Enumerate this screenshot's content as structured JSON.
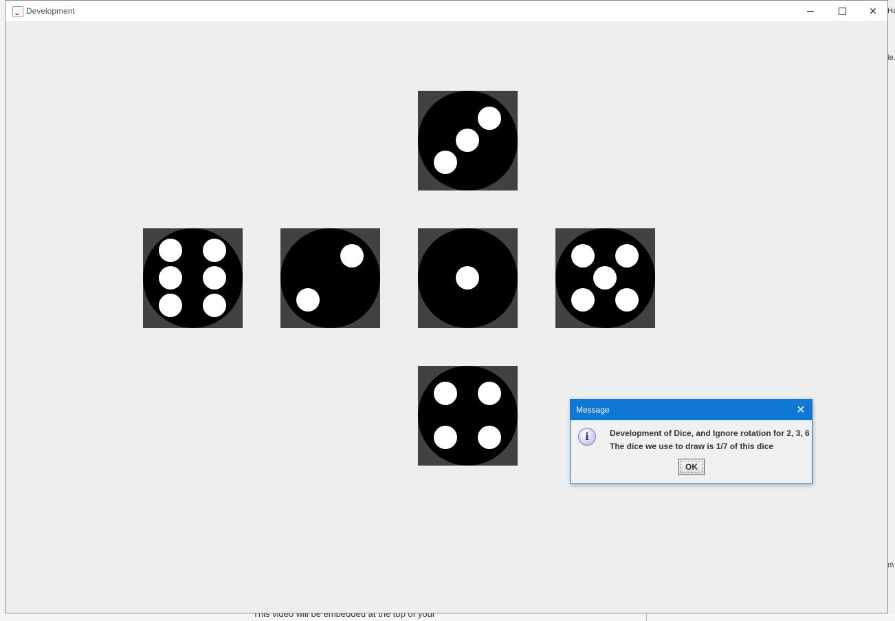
{
  "window": {
    "title": "Development",
    "controls": [
      "minimize-icon",
      "maximize-icon",
      "close-icon"
    ]
  },
  "dice": [
    {
      "face_value": 3
    },
    {
      "face_value": 6
    },
    {
      "face_value": 2
    },
    {
      "face_value": 1
    },
    {
      "face_value": 5
    },
    {
      "face_value": 4
    }
  ],
  "dialog": {
    "title": "Message",
    "icon": "info-icon",
    "icon_glyph": "i",
    "line1": "Development of Dice, and Ignore rotation for 2, 3, 6",
    "line2": "The dice we use to draw is 1/7 of this dice",
    "ok_label": "OK"
  },
  "background": {
    "bottom_text": "This video will be embedded at the top of your",
    "right_fragment_1": "Ha",
    "right_fragment_2": "le.",
    "right_fragment_3": "n\\"
  },
  "colors": {
    "window_bg": "#eeeeee",
    "die_square": "#414141",
    "die_face": "#000000",
    "pip": "#ffffff",
    "dialog_titlebar": "#0f78d7"
  }
}
